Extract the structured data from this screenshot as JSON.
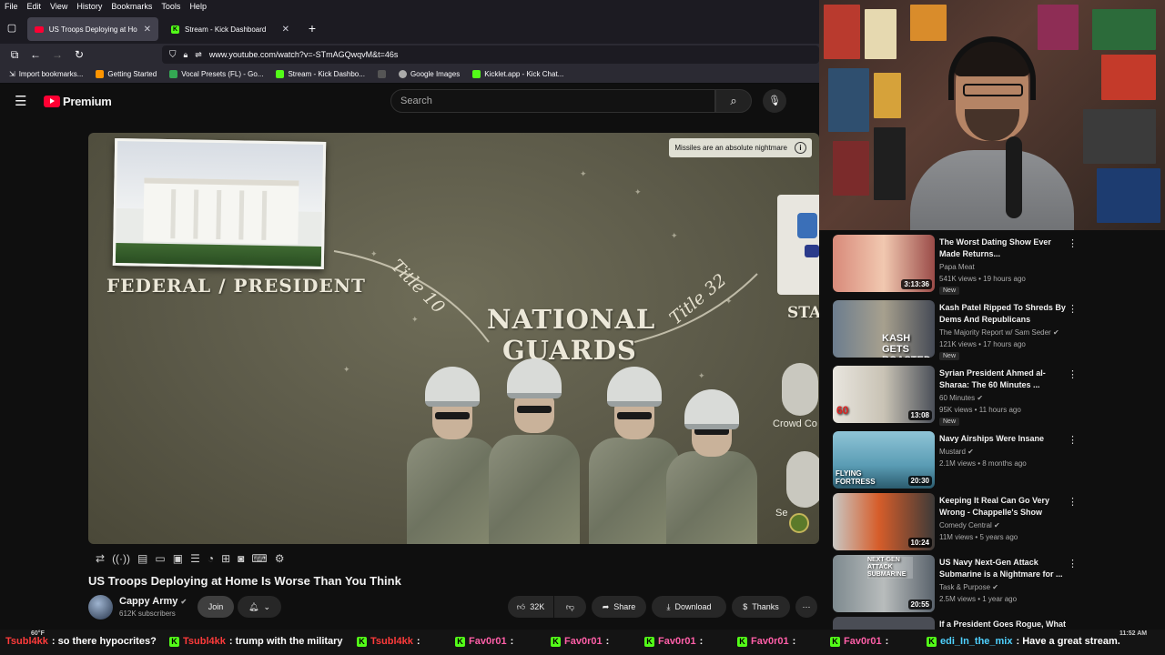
{
  "menubar": [
    "File",
    "Edit",
    "View",
    "History",
    "Bookmarks",
    "Tools",
    "Help"
  ],
  "tabs": [
    {
      "label": "US Troops Deploying at Ho",
      "active": true
    },
    {
      "label": "Stream - Kick Dashboard",
      "active": false
    }
  ],
  "url": "www.youtube.com/watch?v=-STmAGQwqvM&t=46s",
  "bookmarks": [
    "Import bookmarks...",
    "Getting Started",
    "Vocal Presets (FL) - Go...",
    "Stream - Kick Dashbo...",
    "Google Images",
    "Kicklet.app - Kick Chat..."
  ],
  "youtube": {
    "logo_text": "Premium",
    "search_placeholder": "Search"
  },
  "video_frame": {
    "info_text": "Missiles are an absolute nightmare",
    "left_label": "FEDERAL / PRESIDENT",
    "center_line1": "NATIONAL",
    "center_line2": "GUARDS",
    "title10": "Title 10",
    "title32": "Title 32",
    "right_label": "STA",
    "crowd_label": "Crowd Co",
    "right_label2": "Se"
  },
  "video": {
    "title": "US Troops Deploying at Home Is Worse Than You Think",
    "channel": "Cappy Army",
    "subscribers": "612K subscribers",
    "join_label": "Join",
    "likes": "32K",
    "share_label": "Share",
    "download_label": "Download",
    "thanks_label": "Thanks"
  },
  "recommendations": [
    {
      "title": "The Worst Dating Show Ever Made Returns...",
      "channel": "Papa Meat",
      "verified": false,
      "meta": "541K views • 19 hours ago",
      "duration": "3:13:36",
      "new": true
    },
    {
      "title": "Kash Patel Ripped To Shreds By Dems And Republicans",
      "channel": "The Majority Report w/ Sam Seder",
      "verified": true,
      "meta": "121K views • 17 hours ago",
      "duration": "",
      "new": true,
      "thumb_text": "KASH GETS ROASTED"
    },
    {
      "title": "Syrian President Ahmed al-Sharaa: The 60 Minutes ...",
      "channel": "60 Minutes",
      "verified": true,
      "meta": "95K views • 11 hours ago",
      "duration": "13:08",
      "new": true,
      "thumb_text": "60"
    },
    {
      "title": "Navy Airships Were Insane",
      "channel": "Mustard",
      "verified": true,
      "meta": "2.1M views • 8 months ago",
      "duration": "20:30",
      "new": false,
      "thumb_text": "FLYING FORTRESS"
    },
    {
      "title": "Keeping It Real Can Go Very Wrong - Chappelle's Show",
      "channel": "Comedy Central",
      "verified": true,
      "meta": "11M views • 5 years ago",
      "duration": "10:24",
      "new": false
    },
    {
      "title": "US Navy Next-Gen Attack Submarine is a Nightmare for ...",
      "channel": "Task & Purpose",
      "verified": true,
      "meta": "2.5M views • 1 year ago",
      "duration": "20:55",
      "new": false,
      "thumb_text": "NEXT-GEN ATTACK SUBMARINE"
    },
    {
      "title": "If a President Goes Rogue, What",
      "channel": "",
      "verified": false,
      "meta": "",
      "duration": "",
      "new": false
    }
  ],
  "ticker": {
    "weather": "60°F",
    "clock": "11:52 AM",
    "messages": [
      {
        "user": "Tsubl4kk",
        "text": ": so there hypocrites?"
      },
      {
        "user": "Tsubl4kk",
        "text": ": trump with the military"
      },
      {
        "user": "Tsubl4kk",
        "text": ":"
      },
      {
        "user": "Fav0r01",
        "text": ":"
      },
      {
        "user": "Fav0r01",
        "text": ":"
      },
      {
        "user": "Fav0r01",
        "text": ":"
      },
      {
        "user": "Fav0r01",
        "text": ":"
      },
      {
        "user": "Fav0r01",
        "text": ":"
      },
      {
        "user": "edi_In_the_mix",
        "text": ": Have a great stream."
      }
    ]
  },
  "colors": {
    "yt_red": "#ff0033",
    "kick_green": "#53fc18",
    "bg": "#0f0f0f"
  }
}
